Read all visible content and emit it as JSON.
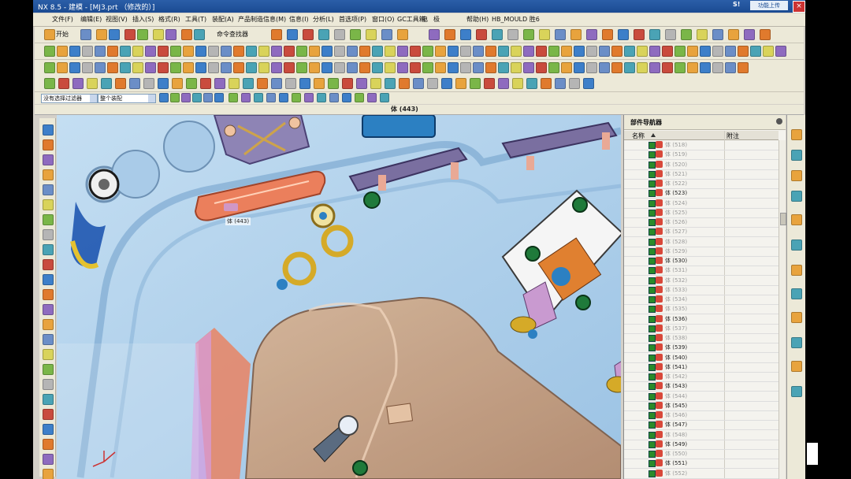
{
  "window": {
    "title": "NX 8.5 - 建模 - [MJ3.prt （修改的）]",
    "brand": "S!",
    "search_label": "功能上传",
    "close_label": "×"
  },
  "menu": [
    "文件(F)",
    "编辑(E)",
    "视图(V)",
    "插入(S)",
    "格式(R)",
    "工具(T)",
    "装配(A)",
    "产品制造信息(M)",
    "信息(I)",
    "分析(L)",
    "首选项(P)",
    "窗口(O)",
    "GC工具箱",
    "电",
    "极",
    "帮助(H)",
    "HB_MOULD 胜6"
  ],
  "toolbar": {
    "start_label": "开始",
    "command_finder_label": "命令查找器"
  },
  "filter": {
    "type_filter": "没有选择过滤器",
    "scope": "整个装配"
  },
  "status_message": "体 (443)",
  "viewport": {
    "hover_label": "体 (443)"
  },
  "navigator": {
    "title": "部件导航器",
    "col_name": "名称",
    "col_note": "附注",
    "rows": [
      {
        "label": "体 (518)",
        "dim": true
      },
      {
        "label": "体 (519)",
        "dim": true
      },
      {
        "label": "体 (520)",
        "dim": true
      },
      {
        "label": "体 (521)",
        "dim": true
      },
      {
        "label": "体 (522)",
        "dim": true
      },
      {
        "label": "体 (523)",
        "dim": false
      },
      {
        "label": "体 (524)",
        "dim": true
      },
      {
        "label": "体 (525)",
        "dim": true
      },
      {
        "label": "体 (526)",
        "dim": true
      },
      {
        "label": "体 (527)",
        "dim": true
      },
      {
        "label": "体 (528)",
        "dim": true
      },
      {
        "label": "体 (529)",
        "dim": true
      },
      {
        "label": "体 (530)",
        "dim": false
      },
      {
        "label": "体 (531)",
        "dim": true
      },
      {
        "label": "体 (532)",
        "dim": true
      },
      {
        "label": "体 (533)",
        "dim": true
      },
      {
        "label": "体 (534)",
        "dim": true
      },
      {
        "label": "体 (535)",
        "dim": true
      },
      {
        "label": "体 (536)",
        "dim": false
      },
      {
        "label": "体 (537)",
        "dim": true
      },
      {
        "label": "体 (538)",
        "dim": true
      },
      {
        "label": "体 (539)",
        "dim": false
      },
      {
        "label": "体 (540)",
        "dim": false
      },
      {
        "label": "体 (541)",
        "dim": false
      },
      {
        "label": "体 (542)",
        "dim": true
      },
      {
        "label": "体 (543)",
        "dim": false
      },
      {
        "label": "体 (544)",
        "dim": true
      },
      {
        "label": "体 (545)",
        "dim": false
      },
      {
        "label": "体 (546)",
        "dim": true
      },
      {
        "label": "体 (547)",
        "dim": false
      },
      {
        "label": "体 (548)",
        "dim": true
      },
      {
        "label": "体 (549)",
        "dim": false
      },
      {
        "label": "体 (550)",
        "dim": true
      },
      {
        "label": "体 (551)",
        "dim": false
      },
      {
        "label": "体 (552)",
        "dim": true
      }
    ]
  },
  "colors": {
    "title_bar": "#1b4b92",
    "viewport_bg": "#b7d6ef",
    "selected_body": "#f07850",
    "fixture_purple": "#7a6fa0",
    "cap_green": "#1f7a3a"
  }
}
